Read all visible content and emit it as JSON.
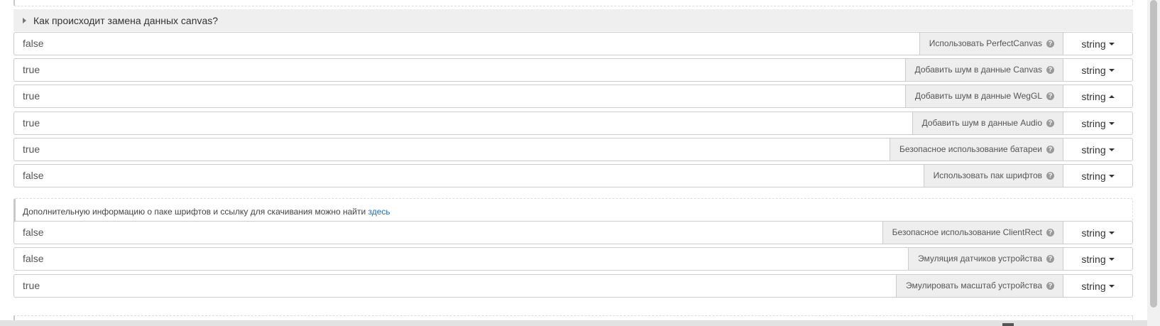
{
  "section": {
    "title": "Как происходит замена данных canvas?"
  },
  "rows": [
    {
      "value": "false",
      "label": "Использовать PerfectCanvas",
      "type": "string",
      "caret": "down"
    },
    {
      "value": "true",
      "label": "Добавить шум в данные Canvas",
      "type": "string",
      "caret": "down"
    },
    {
      "value": "true",
      "label": "Добавить шум в данные WegGL",
      "type": "string",
      "caret": "up"
    },
    {
      "value": "true",
      "label": "Добавить шум в данные Audio",
      "type": "string",
      "caret": "down"
    },
    {
      "value": "true",
      "label": "Безопасное использование батареи",
      "type": "string",
      "caret": "down"
    },
    {
      "value": "false",
      "label": "Использовать пак шрифтов",
      "type": "string",
      "caret": "down"
    },
    {
      "value": "false",
      "label": "Безопасное использование ClientRect",
      "type": "string",
      "caret": "down"
    },
    {
      "value": "false",
      "label": "Эмуляция датчиков устройства",
      "type": "string",
      "caret": "down"
    },
    {
      "value": "true",
      "label": "Эмулировать масштаб устройства",
      "type": "string",
      "caret": "down"
    }
  ],
  "info": {
    "text": "Дополнительную информацию о паке шрифтов и ссылку для скачивания можно найти ",
    "link": "здесь"
  },
  "icons": {
    "help": "question-circle-icon",
    "section_toggle": "caret-right-icon",
    "dropdown": "caret-down-icon"
  },
  "colors": {
    "label_bg": "#eeeeee",
    "header_bg": "#efefef",
    "link": "#2a6db0"
  }
}
